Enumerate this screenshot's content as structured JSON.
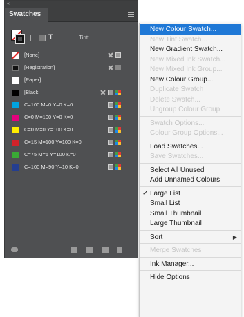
{
  "panel": {
    "title": "Swatches",
    "tint_label": "Tint:",
    "tint_value": "",
    "bottom_icons": [
      "show-swatch-kinds-icon",
      "new-color-group-icon",
      "new-swatch-icon",
      "delete-swatch-icon"
    ]
  },
  "swatches": [
    {
      "name": "[None]",
      "color": "none",
      "icons": [
        "x",
        "lock"
      ]
    },
    {
      "name": "[Registration]",
      "color": "registration",
      "icons": [
        "x",
        "reg"
      ]
    },
    {
      "name": "[Paper]",
      "color": "#ffffff",
      "icons": []
    },
    {
      "name": "[Black]",
      "color": "#000000",
      "icons": [
        "x",
        "grey",
        "cmyk"
      ]
    },
    {
      "name": "C=100 M=0 Y=0 K=0",
      "color": "#00a3e0",
      "icons": [
        "grey",
        "cmyk"
      ]
    },
    {
      "name": "C=0 M=100 Y=0 K=0",
      "color": "#e5007d",
      "icons": [
        "grey",
        "cmyk"
      ]
    },
    {
      "name": "C=0 M=0 Y=100 K=0",
      "color": "#ffed00",
      "icons": [
        "grey",
        "cmyk"
      ]
    },
    {
      "name": "C=15 M=100 Y=100 K=0",
      "color": "#d2232a",
      "icons": [
        "grey",
        "cmyk"
      ]
    },
    {
      "name": "C=75 M=5 Y=100 K=0",
      "color": "#3aaa35",
      "icons": [
        "grey",
        "cmyk"
      ]
    },
    {
      "name": "C=100 M=90 Y=10 K=0",
      "color": "#243e90",
      "icons": [
        "grey",
        "cmyk"
      ]
    }
  ],
  "menu": {
    "items": [
      {
        "label": "New Colour Swatch...",
        "enabled": true,
        "highlighted": true
      },
      {
        "label": "New Tint Swatch...",
        "enabled": false
      },
      {
        "label": "New Gradient Swatch...",
        "enabled": true
      },
      {
        "label": "New Mixed Ink Swatch...",
        "enabled": false
      },
      {
        "label": "New Mixed Ink Group...",
        "enabled": false
      },
      {
        "label": "New Colour Group...",
        "enabled": true
      },
      {
        "label": "Duplicate Swatch",
        "enabled": false
      },
      {
        "label": "Delete Swatch...",
        "enabled": false
      },
      {
        "label": "Ungroup Colour Group",
        "enabled": false
      },
      {
        "separator": true
      },
      {
        "label": "Swatch Options...",
        "enabled": false
      },
      {
        "label": "Colour Group Options...",
        "enabled": false
      },
      {
        "separator": true
      },
      {
        "label": "Load Swatches...",
        "enabled": true
      },
      {
        "label": "Save Swatches...",
        "enabled": false
      },
      {
        "separator": true
      },
      {
        "label": "Select All Unused",
        "enabled": true
      },
      {
        "label": "Add Unnamed Colours",
        "enabled": true
      },
      {
        "separator": true
      },
      {
        "label": "Large List",
        "enabled": true,
        "checked": true
      },
      {
        "label": "Small List",
        "enabled": true
      },
      {
        "label": "Small Thumbnail",
        "enabled": true
      },
      {
        "label": "Large Thumbnail",
        "enabled": true
      },
      {
        "separator": true
      },
      {
        "label": "Sort",
        "enabled": true,
        "submenu": true
      },
      {
        "separator": true
      },
      {
        "label": "Merge Swatches",
        "enabled": false
      },
      {
        "separator": true
      },
      {
        "label": "Ink Manager...",
        "enabled": true
      },
      {
        "separator": true
      },
      {
        "label": "Hide Options",
        "enabled": true
      }
    ]
  }
}
